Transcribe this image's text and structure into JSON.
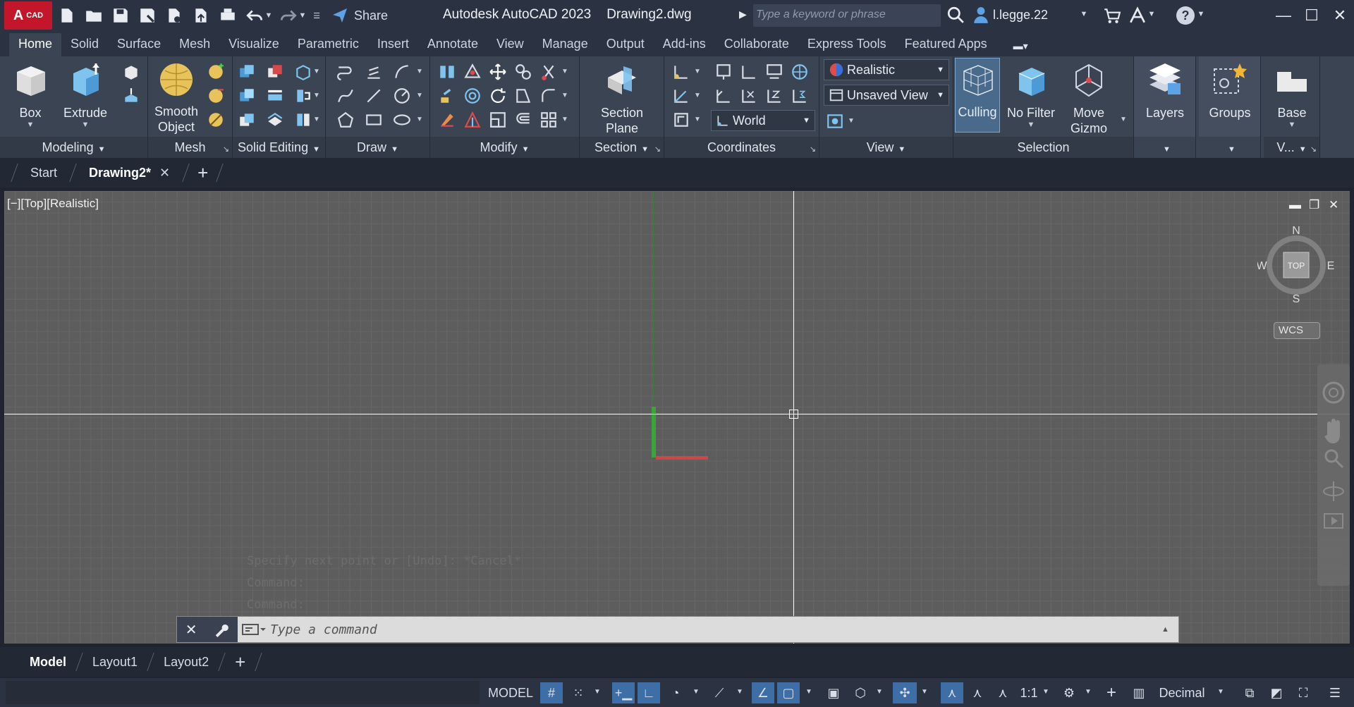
{
  "titlebar": {
    "logo": "A",
    "logo_sub": "CAD",
    "share_label": "Share",
    "app_name": "Autodesk AutoCAD 2023",
    "file_name": "Drawing2.dwg",
    "search_placeholder": "Type a keyword or phrase",
    "user_name": "l.legge.22"
  },
  "ribbon_tabs": [
    "Home",
    "Solid",
    "Surface",
    "Mesh",
    "Visualize",
    "Parametric",
    "Insert",
    "Annotate",
    "View",
    "Manage",
    "Output",
    "Add-ins",
    "Collaborate",
    "Express Tools",
    "Featured Apps"
  ],
  "ribbon": {
    "box_label": "Box",
    "extrude_label": "Extrude",
    "smooth_label_1": "Smooth",
    "smooth_label_2": "Object",
    "section_label_1": "Section",
    "section_label_2": "Plane",
    "visual_style": "Realistic",
    "saved_view": "Unsaved View",
    "ucs": "World",
    "culling_label": "Culling",
    "nofilter_label": "No Filter",
    "move_label_1": "Move",
    "move_label_2": "Gizmo",
    "layers_label": "Layers",
    "groups_label": "Groups",
    "base_label": "Base",
    "panels": {
      "modeling": "Modeling",
      "mesh": "Mesh",
      "solid_editing": "Solid Editing",
      "draw": "Draw",
      "modify": "Modify",
      "section": "Section",
      "coordinates": "Coordinates",
      "view": "View",
      "selection": "Selection",
      "v": "V..."
    }
  },
  "file_tabs": {
    "start": "Start",
    "drawing": "Drawing2*"
  },
  "viewport": {
    "label": "[−][Top][Realistic]",
    "compass": {
      "n": "N",
      "s": "S",
      "e": "E",
      "w": "W",
      "face": "TOP"
    },
    "wcs_label": "WCS"
  },
  "command": {
    "history": [
      "Specify next point or [Undo]: *Cancel*",
      "Command:",
      "Command:"
    ],
    "placeholder": "Type a command"
  },
  "layout_tabs": [
    "Model",
    "Layout1",
    "Layout2"
  ],
  "statusbar": {
    "model_label": "MODEL",
    "scale": "1:1",
    "units": "Decimal"
  },
  "colors": {
    "accent": "#3d6fa6",
    "logo_red": "#c4162b",
    "x_axis": "#d04646",
    "y_axis": "#3aa63a"
  }
}
